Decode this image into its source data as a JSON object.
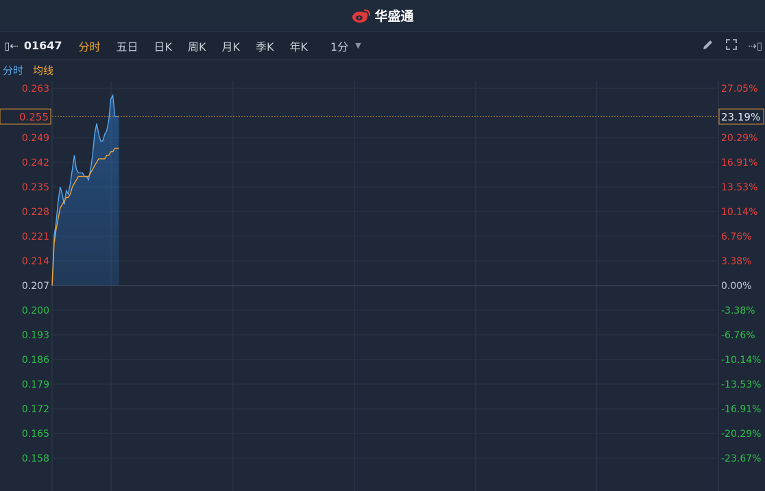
{
  "header": {
    "brand_name": "华盛通",
    "brand_icon": "weibo-style-logo-icon",
    "brand_color": "#e03a3a"
  },
  "toolbar": {
    "stock_code": "01647",
    "tabs": [
      {
        "label": "分时",
        "active": true
      },
      {
        "label": "五日",
        "active": false
      },
      {
        "label": "日K",
        "active": false
      },
      {
        "label": "周K",
        "active": false
      },
      {
        "label": "月K",
        "active": false
      },
      {
        "label": "季K",
        "active": false
      },
      {
        "label": "年K",
        "active": false
      }
    ],
    "interval": "1分",
    "icons": [
      "collapse-left-icon",
      "pencil-icon",
      "fullscreen-icon",
      "collapse-right-icon"
    ]
  },
  "legend": {
    "minute_label": "分时",
    "average_label": "均线",
    "minute_color": "#5aa8ee",
    "average_color": "#f0a535"
  },
  "chart_data": {
    "type": "line",
    "prev_close": 0.207,
    "ylim": [
      0.153,
      0.267
    ],
    "y_ticks_left": [
      "0.263",
      "0.249",
      "0.242",
      "0.235",
      "0.228",
      "0.221",
      "0.214",
      "0.207",
      "0.200",
      "0.193",
      "0.186",
      "0.179",
      "0.172",
      "0.165",
      "0.158"
    ],
    "y_ticks_right": [
      "27.05%",
      "20.29%",
      "16.91%",
      "13.53%",
      "10.14%",
      "6.76%",
      "3.38%",
      "0.00%",
      "-3.38%",
      "-6.76%",
      "-10.14%",
      "-13.53%",
      "-16.91%",
      "-20.29%",
      "-23.67%"
    ],
    "current_price": "0.255",
    "current_change": "23.19%",
    "total_minutes": 330,
    "up_color": "#e8413c",
    "down_color": "#2fc04a",
    "series": [
      {
        "values": [
          0.207,
          0.221,
          0.225,
          0.231,
          0.235,
          0.233,
          0.23,
          0.234,
          0.233,
          0.236,
          0.24,
          0.244,
          0.24,
          0.239,
          0.239,
          0.239,
          0.238,
          0.238,
          0.237,
          0.24,
          0.244,
          0.25,
          0.253,
          0.25,
          0.248,
          0.248,
          0.25,
          0.251,
          0.254,
          0.26,
          0.261,
          0.255,
          0.255,
          0.255
        ]
      },
      {
        "values": [
          0.207,
          0.219,
          0.223,
          0.226,
          0.229,
          0.23,
          0.231,
          0.232,
          0.232,
          0.233,
          0.235,
          0.236,
          0.237,
          0.238,
          0.238,
          0.238,
          0.238,
          0.238,
          0.238,
          0.239,
          0.24,
          0.241,
          0.242,
          0.243,
          0.243,
          0.243,
          0.243,
          0.244,
          0.244,
          0.245,
          0.245,
          0.246,
          0.246,
          0.246
        ]
      }
    ]
  }
}
